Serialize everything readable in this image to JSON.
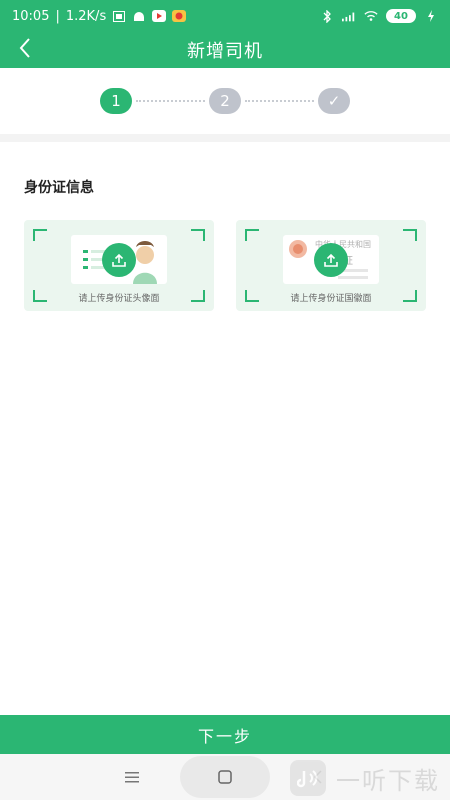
{
  "status_bar": {
    "time": "10:05",
    "network_speed": "1.2K/s",
    "battery_level": "40",
    "icons": [
      "sim-icon",
      "android-icon",
      "play-icon",
      "app-icon",
      "bluetooth-icon",
      "signal-icon",
      "wifi-icon",
      "charging-icon"
    ]
  },
  "header": {
    "title": "新增司机",
    "back_icon": "chevron-left-icon"
  },
  "stepper": {
    "steps": [
      {
        "label": "1",
        "state": "active"
      },
      {
        "label": "2",
        "state": "inactive"
      },
      {
        "label": "✓",
        "state": "inactive"
      }
    ]
  },
  "section": {
    "title": "身份证信息"
  },
  "id_cards": {
    "front": {
      "label": "请上传身份证头像面",
      "icon": "upload-icon"
    },
    "back": {
      "label": "请上传身份证国徽面",
      "icon": "upload-icon",
      "card_text_line1": "中华人民共和国",
      "card_text_line2": "份证"
    }
  },
  "footer": {
    "next_label": "下一步"
  },
  "system_nav": {
    "icons": [
      "menu-icon",
      "home-icon",
      "back-icon"
    ]
  },
  "watermark": {
    "text": "一听下载"
  },
  "colors": {
    "primary": "#2bb673",
    "inactive_step": "#bfc3cc",
    "card_bg": "#ebf6ef"
  }
}
